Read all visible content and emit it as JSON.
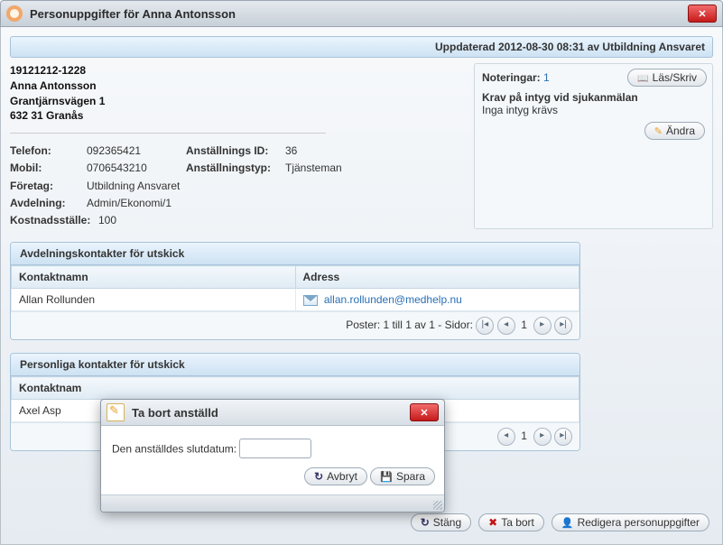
{
  "window": {
    "title": "Personuppgifter för Anna Antonsson"
  },
  "updated_bar": "Uppdaterad 2012-08-30 08:31 av Utbildning Ansvaret",
  "person": {
    "ssn": "19121212-1228",
    "name": "Anna Antonsson",
    "street": "Grantjärnsvägen 1",
    "postal": "632 31 Granås"
  },
  "contact": {
    "telefon_label": "Telefon:",
    "telefon": "092365421",
    "mobil_label": "Mobil:",
    "mobil": "0706543210",
    "foretag_label": "Företag:",
    "foretag": "Utbildning Ansvaret",
    "avdelning_label": "Avdelning:",
    "avdelning": "Admin/Ekonomi/1",
    "kostnad_label": "Kostnadsställe:",
    "kostnad": "100",
    "anst_id_label": "Anställnings ID:",
    "anst_id": "36",
    "anst_typ_label": "Anställningstyp:",
    "anst_typ": "Tjänsteman"
  },
  "notes": {
    "label": "Noteringar:",
    "count": "1",
    "read_write_btn": "Läs/Skriv",
    "krav_label": "Krav på intyg vid sjukanmälan",
    "krav_value": "Inga intyg krävs",
    "change_btn": "Ändra"
  },
  "section_dept": {
    "title": "Avdelningskontakter för utskick",
    "col_name": "Kontaktnamn",
    "col_addr": "Adress",
    "rows": [
      {
        "name": "Allan Rollunden",
        "addr": "allan.rollunden@medhelp.nu"
      }
    ],
    "pager": "Poster: 1 till 1 av 1 - Sidor:",
    "page": "1"
  },
  "section_pers": {
    "title": "Personliga kontakter för utskick",
    "col_name": "Kontaktnam",
    "rows": [
      {
        "name": "Axel Asp"
      }
    ],
    "page": "1"
  },
  "modal": {
    "title": "Ta bort anställd",
    "field_label": "Den anställdes slutdatum:",
    "cancel": "Avbryt",
    "save": "Spara"
  },
  "footer": {
    "close": "Stäng",
    "remove": "Ta bort",
    "edit": "Redigera personuppgifter"
  }
}
